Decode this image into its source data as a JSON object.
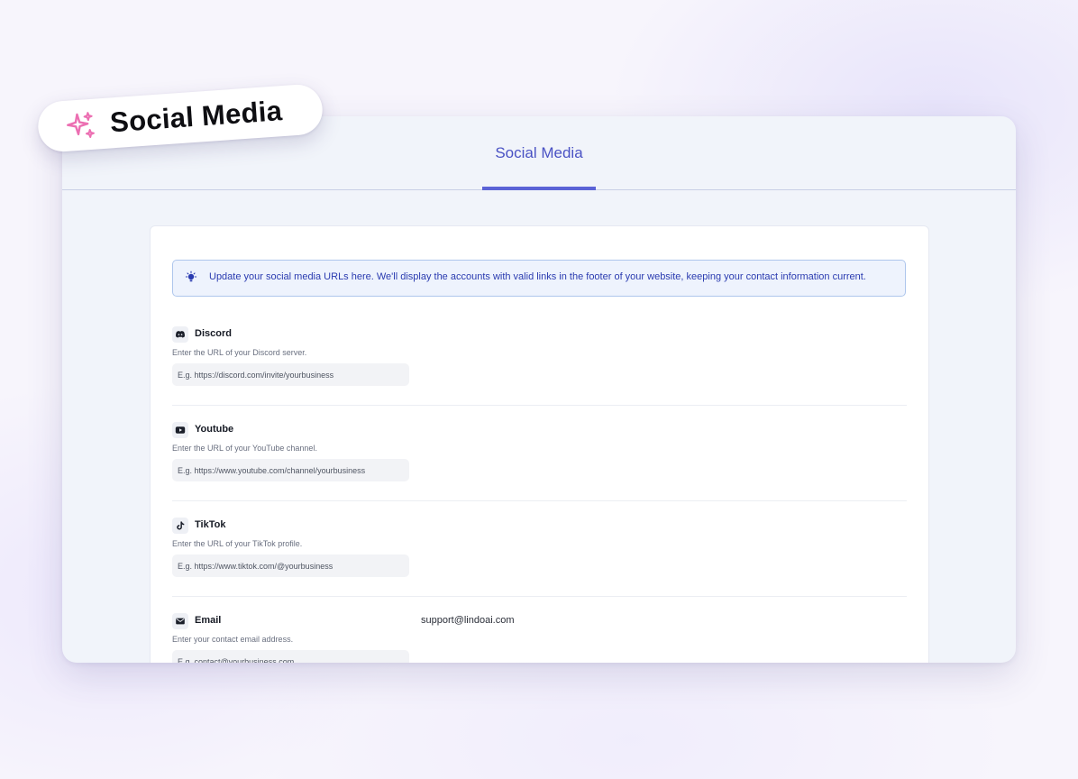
{
  "badge": {
    "icon": "sparkles-icon",
    "label": "Social Media",
    "icon_color": "#ec6fb2"
  },
  "tabs": [
    {
      "label": "Social Media",
      "active": true
    }
  ],
  "info_banner": {
    "icon": "lightbulb-icon",
    "text": "Update your social media URLs here. We'll display the accounts with valid links in the footer of your website, keeping your contact information current."
  },
  "fields": [
    {
      "icon": "discord-icon",
      "title": "Discord",
      "description": "Enter the URL of your Discord server.",
      "placeholder": "E.g. https://discord.com/invite/yourbusiness",
      "value": ""
    },
    {
      "icon": "youtube-icon",
      "title": "Youtube",
      "description": "Enter the URL of your YouTube channel.",
      "placeholder": "E.g. https://www.youtube.com/channel/yourbusiness",
      "value": ""
    },
    {
      "icon": "tiktok-icon",
      "title": "TikTok",
      "description": "Enter the URL of your TikTok profile.",
      "placeholder": "E.g. https://www.tiktok.com/@yourbusiness",
      "value": ""
    },
    {
      "icon": "mail-icon",
      "title": "Email",
      "description": "Enter your contact email address.",
      "placeholder": "E.g. contact@yourbusiness.com",
      "value": "",
      "current_value": "support@lindoai.com"
    }
  ],
  "colors": {
    "accent": "#5b63d6",
    "tab_text": "#4a52c4",
    "banner_bg": "#eef3fd",
    "banner_border": "#aec6ec",
    "banner_text": "#2a3bb0"
  }
}
